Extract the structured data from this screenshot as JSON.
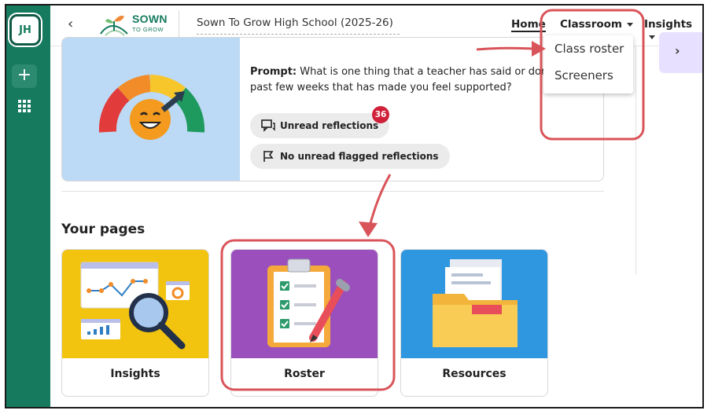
{
  "rail": {
    "avatar_initials": "JH",
    "add_symbol": "+",
    "apps_icon": "grid-icon"
  },
  "header": {
    "back_symbol": "‹",
    "logo_text": "SOWN",
    "logo_sub": "TO GROW",
    "school_name": "Sown To Grow High School (2025-26)",
    "nav": {
      "home": "Home",
      "classroom": "Classroom",
      "insights": "Insights"
    }
  },
  "dropdown": {
    "items": [
      "Class roster",
      "Screeners"
    ]
  },
  "prompt": {
    "label": "Prompt:",
    "line1": " What is one thing that a teacher has said or done in the",
    "line2": "past few weeks that has made you feel supported?",
    "unread_label": "Unread reflections",
    "unread_count": "36",
    "flagged_label": "No unread flagged reflections"
  },
  "your_pages": {
    "title": "Your pages",
    "cards": [
      {
        "label": "Insights",
        "bg": "#f2c40f"
      },
      {
        "label": "Roster",
        "bg": "#9a4fbd"
      },
      {
        "label": "Resources",
        "bg": "#2f96e0"
      }
    ]
  },
  "colors": {
    "brand": "#157a5e",
    "badge": "#d0203a",
    "annotation": "#d9545a"
  }
}
